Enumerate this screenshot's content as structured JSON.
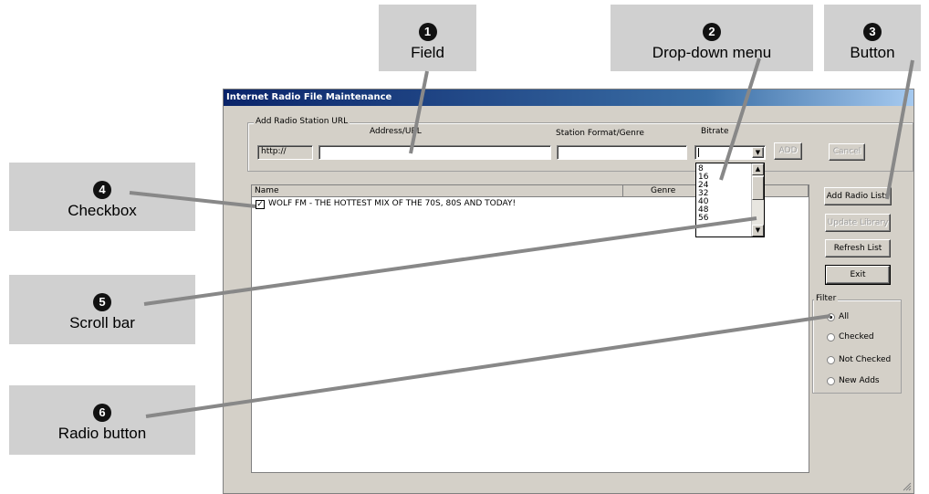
{
  "callouts": [
    {
      "number": "1",
      "label": "Field"
    },
    {
      "number": "2",
      "label": "Drop-down menu"
    },
    {
      "number": "3",
      "label": "Button"
    },
    {
      "number": "4",
      "label": "Checkbox"
    },
    {
      "number": "5",
      "label": "Scroll bar"
    },
    {
      "number": "6",
      "label": "Radio button"
    }
  ],
  "window": {
    "title": "Internet Radio File Maintenance",
    "add_group": {
      "legend": "Add Radio Station URL",
      "address_label": "Address/URL",
      "format_label": "Station Format/Genre",
      "bitrate_label": "Bitrate",
      "prefix": "http://",
      "address_value": "",
      "format_value": "",
      "bitrate_value": "",
      "add_button": "ADD",
      "cancel_button": "Cancel"
    },
    "bitrate_options": [
      "8",
      "16",
      "24",
      "32",
      "40",
      "48",
      "56"
    ],
    "list": {
      "columns": [
        "Name",
        "Genre"
      ],
      "rows": [
        {
          "checked": true,
          "name": "WOLF FM - THE HOTTEST MIX OF THE 70S, 80S AND TODAY!",
          "genre": ""
        }
      ]
    },
    "buttons": {
      "add_radio_lists": "Add Radio Lists",
      "update_library": "Update Library",
      "refresh_list": "Refresh List",
      "exit": "Exit"
    },
    "filter": {
      "legend": "Filter",
      "options": [
        "All",
        "Checked",
        "Not Checked",
        "New Adds"
      ],
      "selected": "All"
    }
  }
}
